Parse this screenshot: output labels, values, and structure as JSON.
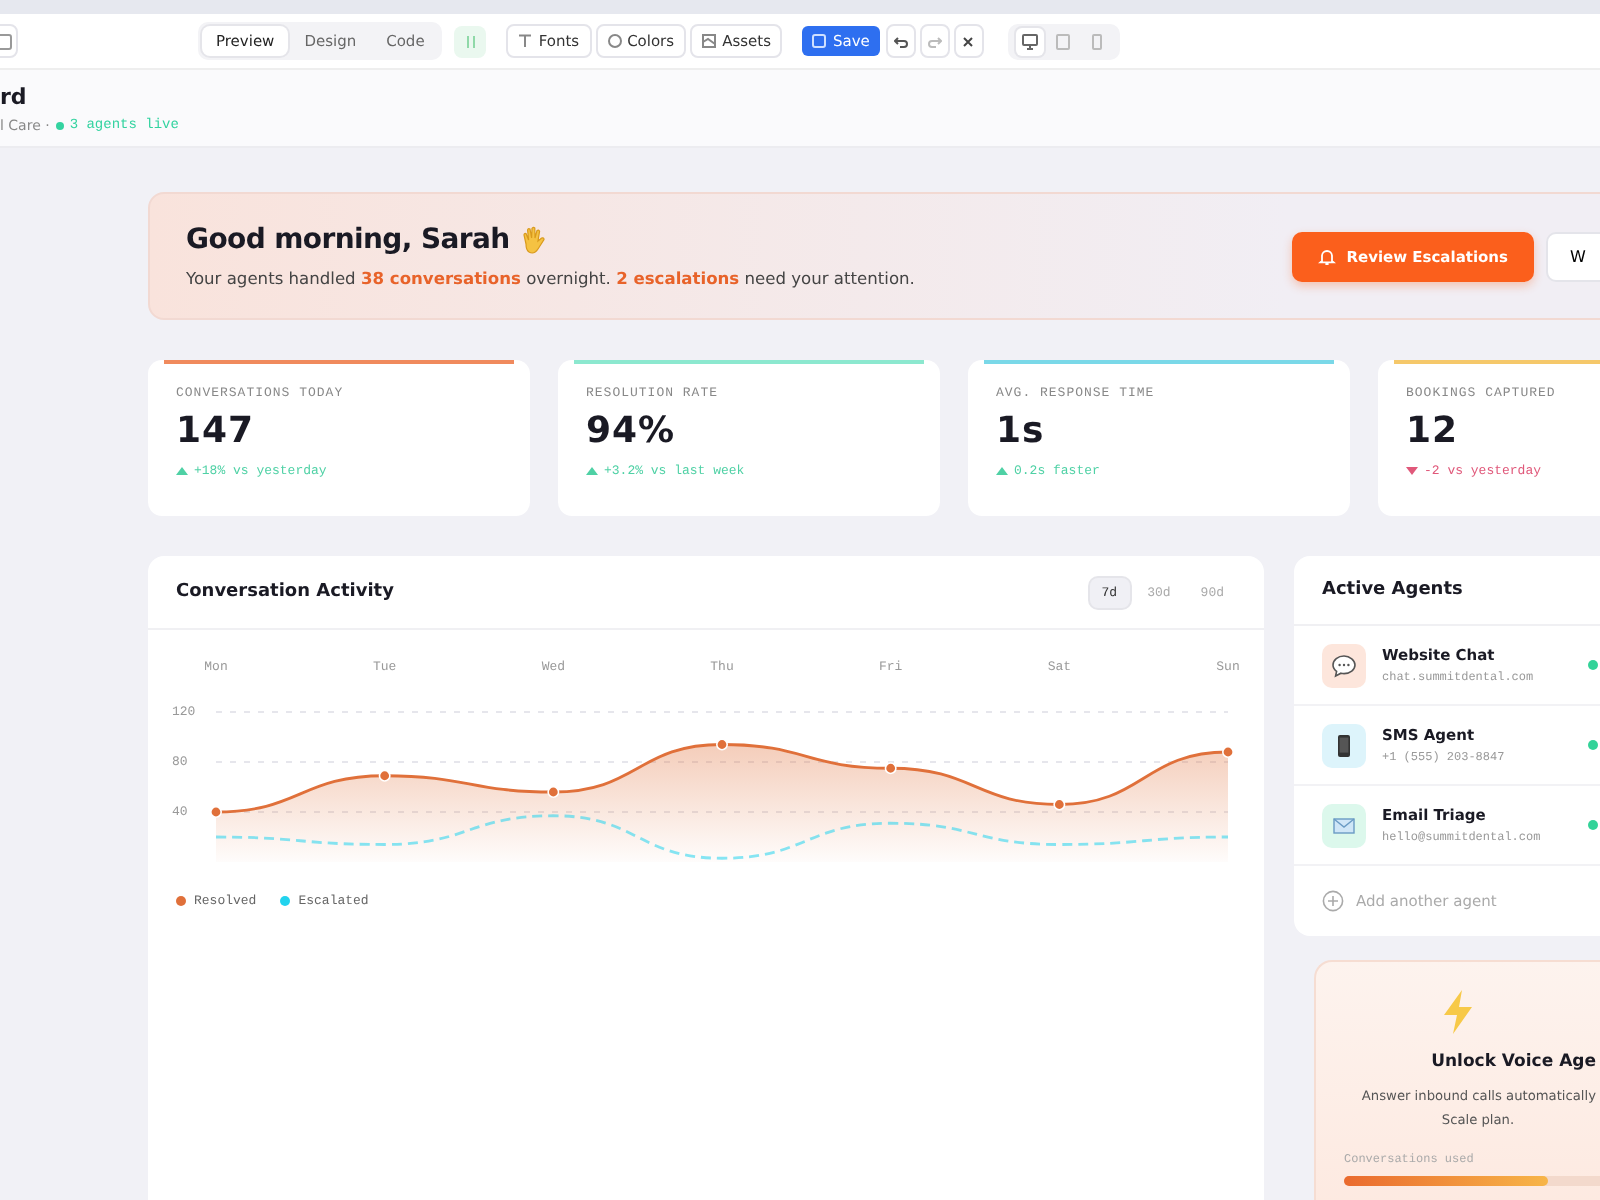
{
  "toolbar": {
    "view_tabs": [
      {
        "label": "Preview",
        "selected": true
      },
      {
        "label": "Design",
        "selected": false
      },
      {
        "label": "Code",
        "selected": false
      }
    ],
    "asset_buttons": [
      {
        "kind": "fonts",
        "label": "Fonts"
      },
      {
        "kind": "colors",
        "label": "Colors"
      },
      {
        "kind": "assets",
        "label": "Assets"
      }
    ],
    "save_label": "Save",
    "devices": [
      {
        "kind": "desktop",
        "selected": true
      },
      {
        "kind": "tablet",
        "selected": false
      },
      {
        "kind": "mobile",
        "selected": false
      }
    ]
  },
  "page_header": {
    "title": "rd",
    "subtitle": "l Care ·",
    "live_status": "3 agents live"
  },
  "banner": {
    "greeting": "Good morning, Sarah",
    "message": "Your agents handled **38 conversations** overnight. **2 escalations** need your attention.",
    "primary_button": "Review Escalations",
    "secondary_button": "W"
  },
  "stats": [
    {
      "label": "CONVERSATIONS TODAY",
      "value": "147",
      "change": "+18% vs yesterday",
      "positive": true,
      "color": "#f08a5d"
    },
    {
      "label": "RESOLUTION RATE",
      "value": "94%",
      "change": "+3.2% vs last week",
      "positive": true,
      "color": "#8ce8cf"
    },
    {
      "label": "AVG. RESPONSE TIME",
      "value": "1s",
      "change": "0.2s faster",
      "positive": true,
      "color": "#7ad8e8"
    },
    {
      "label": "BOOKINGS CAPTURED",
      "value": "12",
      "change": "-2 vs yesterday",
      "positive": false,
      "color": "#f5c86a"
    }
  ],
  "activity": {
    "title": "Conversation Activity",
    "ranges": [
      {
        "label": "7d",
        "selected": true
      },
      {
        "label": "30d",
        "selected": false
      },
      {
        "label": "90d",
        "selected": false
      }
    ],
    "chart_data": {
      "type": "area",
      "categories": [
        "Mon",
        "Tue",
        "Wed",
        "Thu",
        "Fri",
        "Sat",
        "Sun"
      ],
      "ylim": [
        0,
        120
      ],
      "yticks": [
        40,
        80,
        120
      ],
      "series": [
        {
          "name": "Resolved",
          "color": "#e0703a",
          "type": "area",
          "line_style": "solid",
          "marker": "circle",
          "values": [
            40,
            69,
            56,
            94,
            75,
            46,
            88
          ]
        },
        {
          "name": "Escalated",
          "color": "#22d3ee",
          "type": "line",
          "line_style": "dashed",
          "marker": "none",
          "values": [
            20,
            14,
            37,
            3,
            31,
            14,
            20
          ]
        }
      ]
    }
  },
  "agents": {
    "title": "Active Agents",
    "items": [
      {
        "kind": "chat",
        "name": "Website Chat",
        "detail": "chat.summitdental.com",
        "color": "#fde6dc",
        "online": true
      },
      {
        "kind": "sms",
        "name": "SMS Agent",
        "detail": "+1 (555) 203-8847",
        "color": "#ddf4fb",
        "online": true
      },
      {
        "kind": "email",
        "name": "Email Triage",
        "detail": "hello@summitdental.com",
        "color": "#dcf8ec",
        "online": true
      }
    ],
    "add_label": "Add another agent"
  },
  "upsell": {
    "title": "Unlock Voice Age",
    "line_1": "Answer inbound calls automatically",
    "line_2": "Scale plan.",
    "usage_label": "Conversations used",
    "level": 0.8
  }
}
